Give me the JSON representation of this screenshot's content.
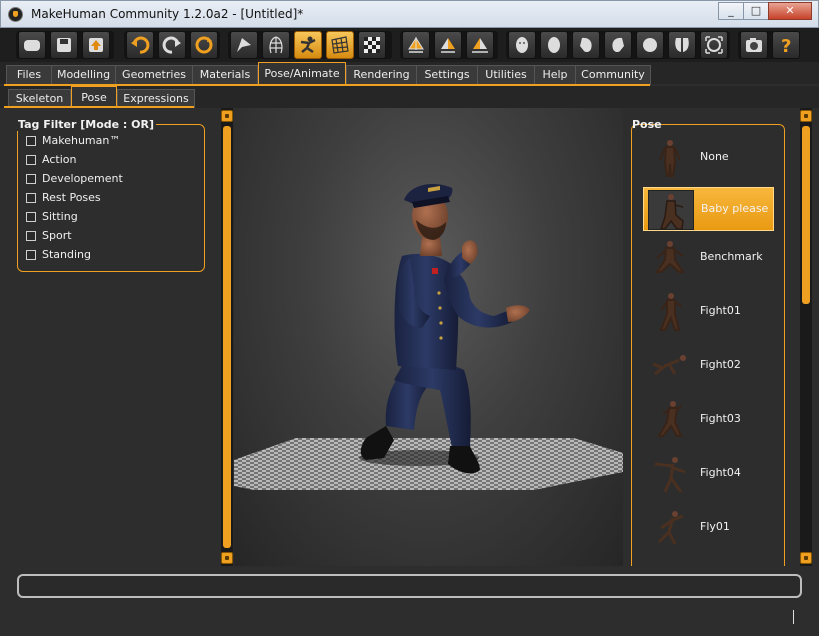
{
  "window": {
    "title": "MakeHuman Community 1.2.0a2 - [Untitled]*",
    "controls": [
      "_",
      "□",
      "✕"
    ]
  },
  "toolbar": {
    "buttons": [
      {
        "name": "new-icon"
      },
      {
        "name": "save-icon"
      },
      {
        "name": "export-icon"
      },
      {
        "name": "undo-icon"
      },
      {
        "name": "redo-icon"
      },
      {
        "name": "reset-icon"
      },
      {
        "name": "smooth-icon"
      },
      {
        "name": "wireframe-icon"
      },
      {
        "name": "pose-icon",
        "active": true
      },
      {
        "name": "grid-icon",
        "active": true
      },
      {
        "name": "background-icon"
      },
      {
        "name": "symmetry-right-icon"
      },
      {
        "name": "symmetry-left-icon"
      },
      {
        "name": "symmetry-icon"
      },
      {
        "name": "front-view-icon"
      },
      {
        "name": "back-view-icon"
      },
      {
        "name": "left-view-icon"
      },
      {
        "name": "right-view-icon"
      },
      {
        "name": "top-view-icon"
      },
      {
        "name": "bottom-view-icon"
      },
      {
        "name": "reset-camera-icon"
      },
      {
        "name": "screenshot-icon"
      },
      {
        "name": "help-icon"
      }
    ]
  },
  "tabs": {
    "main": [
      "Files",
      "Modelling",
      "Geometries",
      "Materials",
      "Pose/Animate",
      "Rendering",
      "Settings",
      "Utilities",
      "Help",
      "Community"
    ],
    "main_active": "Pose/Animate",
    "sub": [
      "Skeleton",
      "Pose",
      "Expressions"
    ],
    "sub_active": "Pose"
  },
  "tag_filter": {
    "title": "Tag Filter [Mode : OR]",
    "items": [
      "Makehuman™",
      "Action",
      "Developement",
      "Rest Poses",
      "Sitting",
      "Sport",
      "Standing"
    ]
  },
  "pose_list": {
    "title": "Pose",
    "items": [
      {
        "label": "None",
        "selected": false
      },
      {
        "label": "Baby please",
        "selected": true
      },
      {
        "label": "Benchmark",
        "selected": false
      },
      {
        "label": "Fight01",
        "selected": false
      },
      {
        "label": "Fight02",
        "selected": false
      },
      {
        "label": "Fight03",
        "selected": false
      },
      {
        "label": "Fight04",
        "selected": false
      },
      {
        "label": "Fly01",
        "selected": false
      }
    ]
  },
  "colors": {
    "accent": "#f0a020",
    "background": "#2d2d2d",
    "uniform": "#1f2a4a"
  }
}
